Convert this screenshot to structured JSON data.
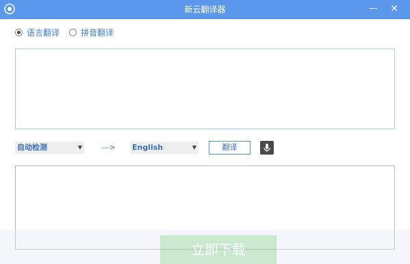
{
  "window": {
    "title": "新云翻译器",
    "min_icon": "minimize-icon",
    "close_icon": "close-icon"
  },
  "mode": {
    "options": [
      {
        "label": "语言翻译",
        "selected": true
      },
      {
        "label": "拼音翻译",
        "selected": false
      }
    ]
  },
  "source_text": "",
  "controls": {
    "source_language": "自动检测",
    "arrow": "--->",
    "target_language": "English",
    "translate_label": "翻译",
    "mic_icon": "microphone-icon"
  },
  "output_text": "",
  "colors": {
    "titlebar": "#5b97ea",
    "accent": "#3f7fd8"
  },
  "overlay": {
    "download_label": "立即下载"
  }
}
